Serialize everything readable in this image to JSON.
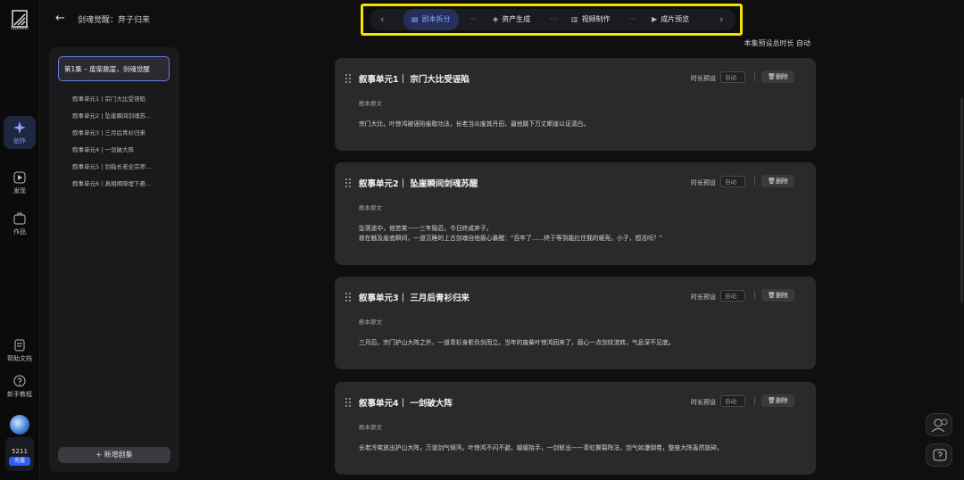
{
  "rail": {
    "logo_text": "LuxReel",
    "nav": [
      {
        "label": "创作",
        "icon": "sparkle-icon"
      },
      {
        "label": "发现",
        "icon": "play-icon"
      },
      {
        "label": "作品",
        "icon": "folder-icon"
      },
      {
        "label": "帮助文档",
        "icon": "document-icon"
      },
      {
        "label": "新手教程",
        "icon": "question-icon"
      }
    ],
    "credits": "5211",
    "recharge_label": "充值"
  },
  "header": {
    "breadcrumb": "剑魂觉醒：弃子归来"
  },
  "toolbar": {
    "steps": [
      {
        "label": "剧本拆分",
        "icon": "script-icon"
      },
      {
        "label": "资产生成",
        "icon": "cube-icon"
      },
      {
        "label": "视频制作",
        "icon": "video-icon"
      },
      {
        "label": "成片预览",
        "icon": "preview-icon"
      }
    ],
    "dots": "···",
    "prev": "‹",
    "next": "›"
  },
  "summary": {
    "total_duration": "本集预设总时长  自动"
  },
  "sidebar": {
    "episode": "第1集 – 废柴跳崖，剑魂觉醒",
    "units": [
      "叙事单元1 | 宗门大比受诬陷",
      "叙事单元2 | 坠崖瞬间剑魂苏…",
      "叙事单元3 | 三月后青衫归来",
      "叙事单元4 | 一剑破大阵",
      "叙事单元5 | 剑指长老全宗师…",
      "叙事单元6 | 真相揭晓埋下悬…"
    ],
    "add_episode": "+ 新增剧集"
  },
  "cards": [
    {
      "title": "叙事单元1｜ 宗门大比受诬陷",
      "duration_label": "时长预设",
      "duration_value": "自动",
      "delete_label": "删除",
      "section_label": "剧本原文",
      "text": "宗门大比，叶惊鸿被诬陷偷取功法，长老当众废其丹田，逼他跳下万丈断崖以证清白。"
    },
    {
      "title": "叙事单元2｜ 坠崖瞬间剑魂苏醒",
      "duration_label": "时长预设",
      "duration_value": "自动",
      "delete_label": "删除",
      "section_label": "剧本原文",
      "text": "坠落途中，他苦笑——三年隐忍，今日终成弃子。\n就在触及崖底瞬间，一道沉睡的上古剑魂自他眉心暴醒：“百年了……终于等到能扛住我的躯壳。小子，想活吗？”"
    },
    {
      "title": "叙事单元3｜ 三月后青衫归来",
      "duration_label": "时长预设",
      "duration_value": "自动",
      "delete_label": "删除",
      "section_label": "剧本原文",
      "text": "三月后，宗门护山大阵之外，一道青衫身影负剑而立。当年的废柴叶惊鸿回来了，眉心一点剑纹流转，气息深不见底。"
    },
    {
      "title": "叙事单元4｜ 一剑破大阵",
      "duration_label": "时长预设",
      "duration_value": "自动",
      "delete_label": "删除",
      "section_label": "剧本原文",
      "text": "长老冷笑放出护山大阵，万道剑气倾泻。叶惊鸿不闪不避，缓缓抬手，一剑斩出——青虹撕裂阵法，剑气如瀑倒卷，整座大阵轰然崩碎。"
    }
  ]
}
